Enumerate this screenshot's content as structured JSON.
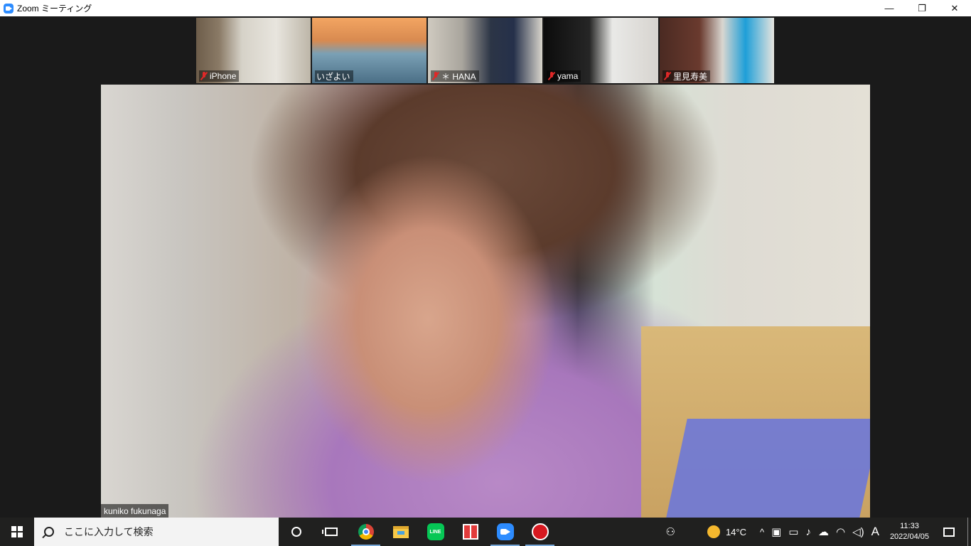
{
  "window": {
    "title": "Zoom ミーティング",
    "minimize_glyph": "—",
    "restore_glyph": "❐",
    "close_glyph": "✕"
  },
  "thumbnails": [
    {
      "name": "iPhone"
    },
    {
      "name": "いざよい"
    },
    {
      "name": "＊ HANA"
    },
    {
      "name": "yama"
    },
    {
      "name": "里見寿美"
    }
  ],
  "main_video": {
    "participant_name": "kuniko fukunaga"
  },
  "taskbar": {
    "search_placeholder": "ここに入力して検索",
    "apps": [
      "cortana",
      "task-view",
      "chrome",
      "file-explorer",
      "line",
      "gift",
      "zoom",
      "trend-micro"
    ],
    "line_label": "LINE",
    "tray": {
      "temperature": "14°C",
      "chevron": "^",
      "ime": "A",
      "time": "11:33",
      "date": "2022/04/05"
    }
  }
}
